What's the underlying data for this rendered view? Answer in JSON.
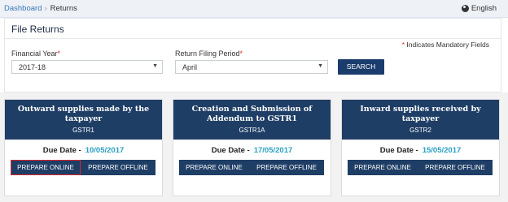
{
  "breadcrumb": {
    "dashboard": "Dashboard",
    "separator": "›",
    "current": "Returns"
  },
  "language": "English",
  "page_title": "File Returns",
  "mandatory_note": {
    "star": "*",
    "text": "Indicates Mandatory Fields"
  },
  "form": {
    "financial_year": {
      "label": "Financial Year",
      "required_mark": "*",
      "value": "2017-18"
    },
    "return_period": {
      "label": "Return Filing Period",
      "required_mark": "*",
      "value": "April"
    },
    "search_label": "SEARCH"
  },
  "cards": [
    {
      "title": "Outward supplies made by the taxpayer",
      "code": "GSTR1",
      "due_label": "Due Date -",
      "due_date": "10/05/2017",
      "online_label": "PREPARE ONLINE",
      "offline_label": "PREPARE OFFLINE"
    },
    {
      "title": "Creation and Submission of Addendum to GSTR1",
      "code": "GSTR1A",
      "due_label": "Due Date -",
      "due_date": "17/05/2017",
      "online_label": "PREPARE ONLINE",
      "offline_label": "PREPARE OFFLINE"
    },
    {
      "title": "Inward supplies received by taxpayer",
      "code": "GSTR2",
      "due_label": "Due Date -",
      "due_date": "15/05/2017",
      "online_label": "PREPARE ONLINE",
      "offline_label": "PREPARE OFFLINE"
    }
  ],
  "colors": {
    "navy": "#1f3e66",
    "accent_blue": "#2aa1c4",
    "required_red": "#d9262b",
    "highlight_red": "#d9262b"
  }
}
